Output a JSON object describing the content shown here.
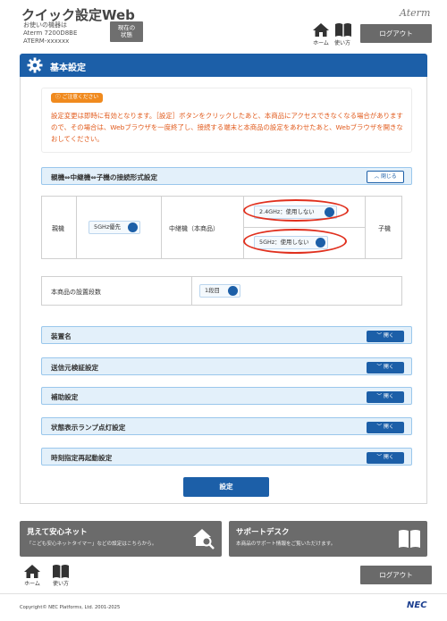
{
  "header": {
    "app_title": "クイック設定Web",
    "device_caption": "お使いの機器は",
    "device_model": "Aterm 7200D8BE",
    "device_ssid": "ATERM-xxxxxx",
    "status_button_line1": "現在の",
    "status_button_line2": "状態",
    "logo": "Aterm",
    "home_label": "ホーム",
    "help_label": "使い方",
    "logout_label": "ログアウト"
  },
  "main": {
    "title": "基本設定",
    "caution": {
      "badge": "ご注意ください",
      "text": "設定変更は即時に有効となります。［設定］ボタンをクリックしたあと、本商品にアクセスできなくなる場合がありますので、その場合は、Webブラウザを一度終了し、接続する端末と本商品の設定をあわせたあと、Webブラウザを開きなおしてください。"
    },
    "connection": {
      "title": "親機⇔中継機⇔子機の接続形式設定",
      "toggle_label": "閉じる",
      "parent_label": "親機",
      "parent_value": "5GHz優先",
      "relay_label": "中継機（本商品）",
      "band24_value": "2.4GHz：使用しない",
      "band5_value": "5GHz：使用しない",
      "child_label": "子機"
    },
    "tier": {
      "label": "本商品の設置段数",
      "value": "1段目"
    },
    "sections": [
      {
        "title": "装置名",
        "toggle": "開く"
      },
      {
        "title": "送信元検証設定",
        "toggle": "開く"
      },
      {
        "title": "補助設定",
        "toggle": "開く"
      },
      {
        "title": "状態表示ランプ点灯設定",
        "toggle": "開く"
      },
      {
        "title": "時刻指定再起動設定",
        "toggle": "開く"
      }
    ],
    "submit_label": "設定"
  },
  "cards": {
    "safety_title": "見えて安心ネット",
    "safety_desc": "「こども安心ネットタイマー」などの設定はこちらから。",
    "support_title": "サポートデスク",
    "support_desc": "本商品のサポート情報をご覧いただけます。"
  },
  "footer": {
    "home_label": "ホーム",
    "help_label": "使い方",
    "logout_label": "ログアウト",
    "copyright": "Copyright© NEC Platforms, Ltd. 2001-2025",
    "brand": "NEC"
  },
  "colors": {
    "primary": "#1c5fa8",
    "caution_text": "#e15a1b",
    "caution_badge": "#f08a1e",
    "highlight_ring": "#e0301e",
    "section_bg": "#e3f0fa"
  }
}
